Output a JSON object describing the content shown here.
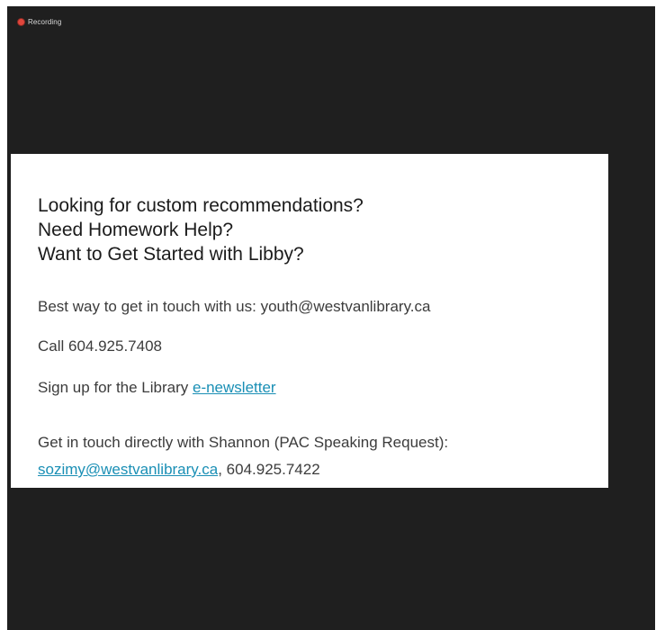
{
  "recording": {
    "label": "Recording"
  },
  "slide": {
    "headline": [
      "Looking for custom recommendations?",
      "Need Homework Help?",
      "Want to Get Started with Libby?"
    ],
    "contact_line": "Best way to get in touch with us: youth@westvanlibrary.ca",
    "call_line": "Call 604.925.7408",
    "newsletter_prefix": "Sign up for the Library ",
    "newsletter_link": "e-newsletter",
    "direct_line": "Get in touch directly with Shannon (PAC Speaking Request):",
    "direct_email": "sozimy@westvanlibrary.ca",
    "direct_phone": ", 604.925.7422"
  },
  "colors": {
    "background": "#1f1f1f",
    "slide": "#ffffff",
    "link": "#1a8fb5",
    "recording_dot": "#e0463c"
  }
}
